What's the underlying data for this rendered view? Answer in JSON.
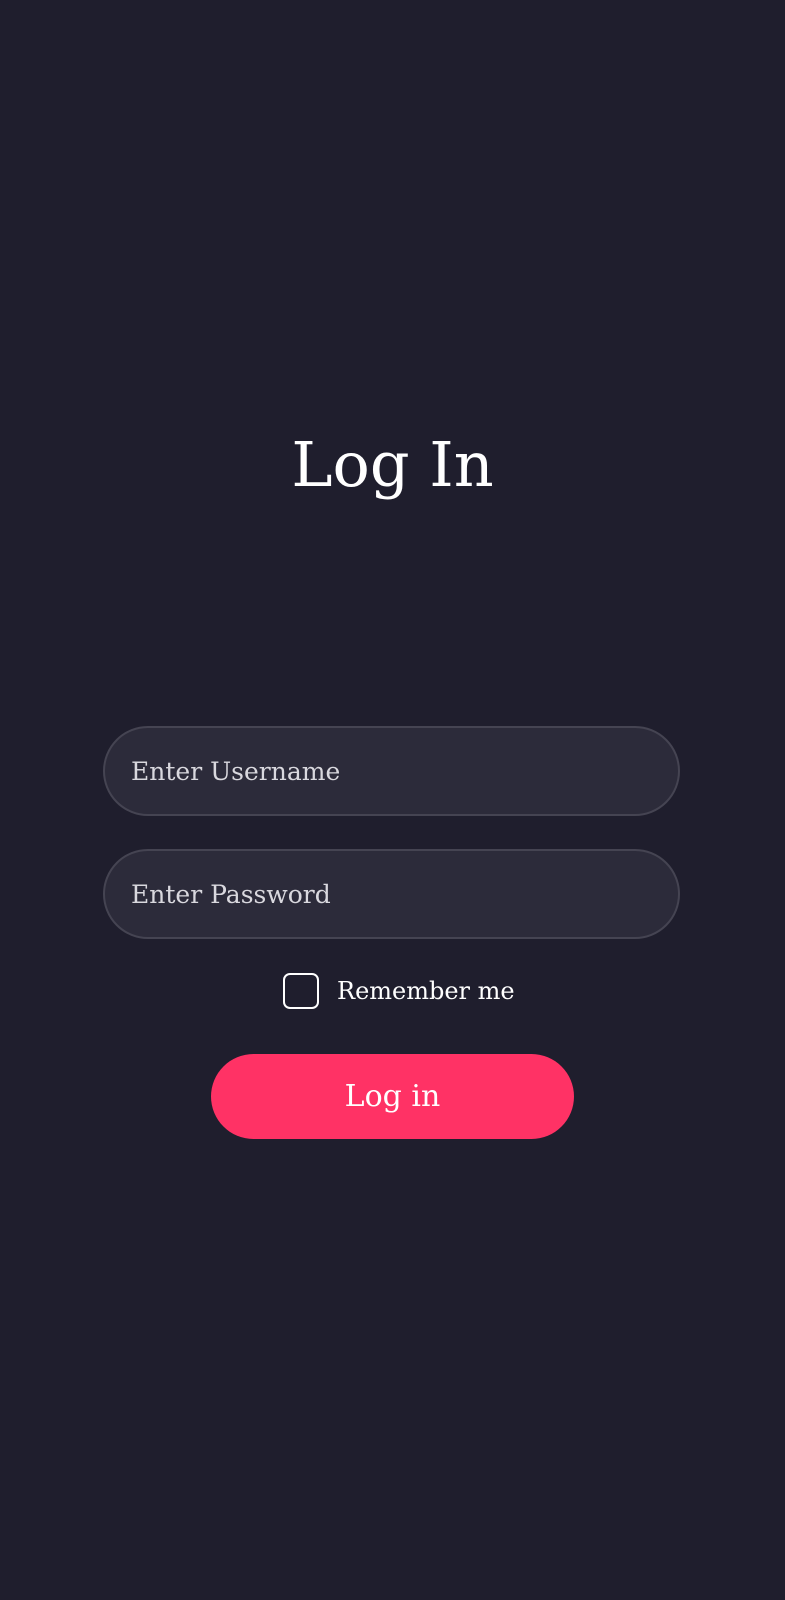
{
  "page": {
    "title": "Log In"
  },
  "form": {
    "username": {
      "value": "",
      "placeholder": "Enter Username"
    },
    "password": {
      "value": "",
      "placeholder": "Enter Password"
    },
    "remember_me": {
      "label": "Remember me",
      "checked": false
    },
    "submit_label": "Log in"
  },
  "colors": {
    "background": "#1f1e2d",
    "field_background": "#2c2b3a",
    "field_border": "#454452",
    "accent": "#ff3265",
    "text": "#ffffff"
  }
}
